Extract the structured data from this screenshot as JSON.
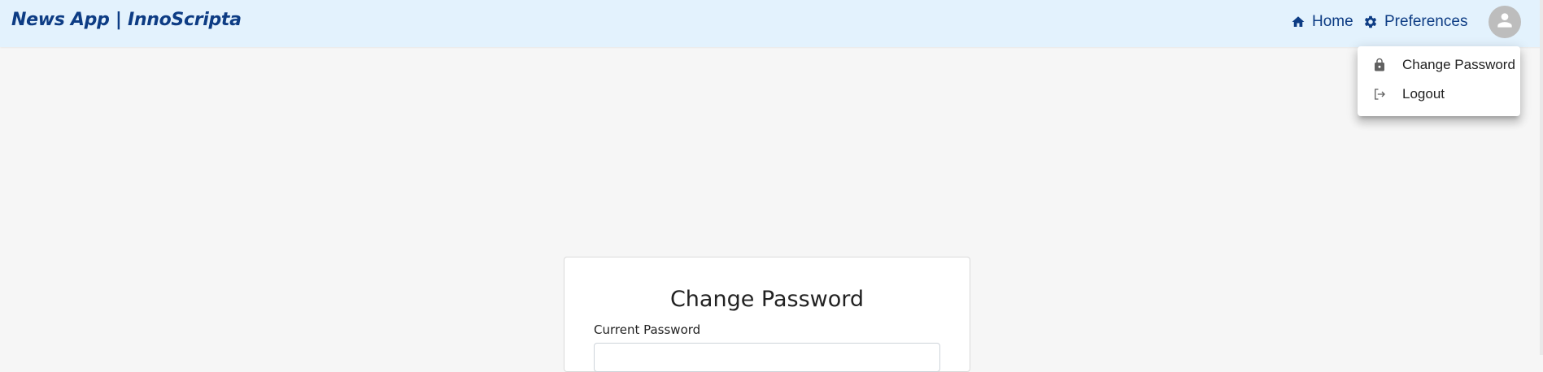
{
  "header": {
    "brand": "News App | InnoScripta",
    "nav": {
      "home_label": "Home",
      "home_icon": "home-icon",
      "preferences_label": "Preferences",
      "preferences_icon": "gear-icon"
    },
    "avatar_icon": "person-icon"
  },
  "user_menu": {
    "items": [
      {
        "label": "Change Password",
        "icon": "lock-icon"
      },
      {
        "label": "Logout",
        "icon": "logout-icon"
      }
    ]
  },
  "form": {
    "title": "Change Password",
    "current_password": {
      "label": "Current Password",
      "value": ""
    }
  },
  "colors": {
    "header_bg": "#e3f2fd",
    "brand": "#0d3c84",
    "page_bg": "#f6f6f6",
    "avatar_bg": "#bdbdbd"
  }
}
